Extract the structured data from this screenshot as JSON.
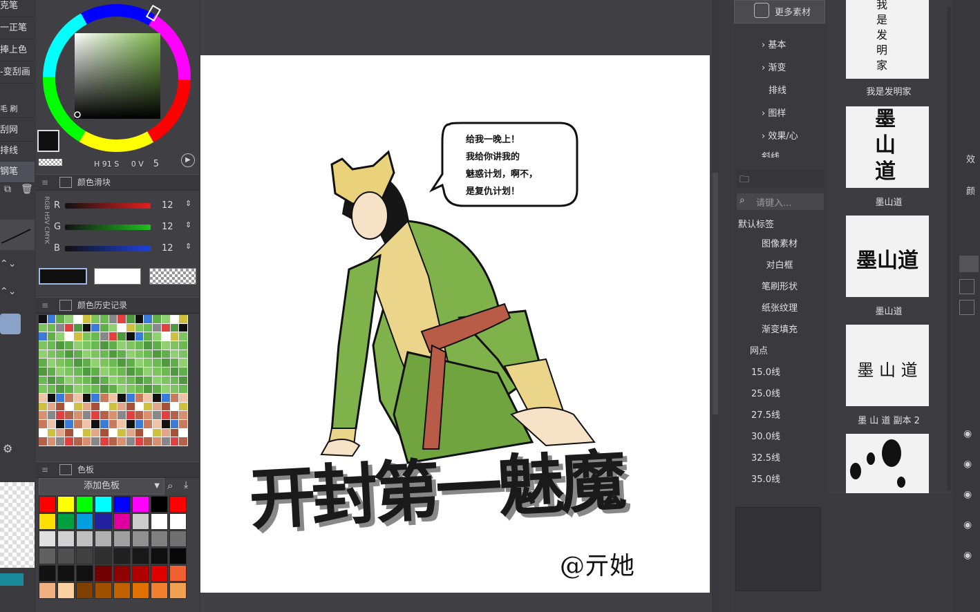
{
  "tool_strip": {
    "items": [
      "克笔",
      "一正笔",
      "捧上色",
      "-变刮画",
      "毛 刷",
      "刮网",
      "排线",
      "钢笔"
    ]
  },
  "color_panel": {
    "hsv_readout": {
      "h_label": "H",
      "h": "91",
      "s_label": "S",
      "v_label": "V",
      "v": "0",
      "extra": "5"
    },
    "slider_panel_title": "颜色滑块",
    "sliders": [
      {
        "label": "R",
        "value": "12",
        "color": "#e02020"
      },
      {
        "label": "G",
        "value": "12",
        "color": "#20c020"
      },
      {
        "label": "B",
        "value": "12",
        "color": "#2040e0"
      }
    ],
    "mode_labels": [
      "RGB",
      "HSV",
      "CMYK"
    ],
    "history_title": "颜色历史记录",
    "palette_title": "色板",
    "palette_select": "添加色板",
    "current_color": "#101010",
    "wheel_ring_color": "#7ab648"
  },
  "canvas": {
    "speech_bubble": [
      "给我一晚上！",
      "我给你讲我的",
      "魅惑计划，啊不，",
      "是复仇计划！"
    ],
    "title_art": "开封第一魅魔",
    "signature": "@亓她"
  },
  "material_tree": {
    "more_materials": "更多素材",
    "items": [
      "基本",
      "渐变",
      "排线",
      "图样",
      "效果/心",
      "斜线"
    ],
    "search_placeholder": "请键入...",
    "tags_header": "默认标签",
    "tags": [
      "图像素材",
      "对白框",
      "笔刷形状",
      "纸张纹理",
      "渐变填充",
      "网点",
      "15.0线",
      "25.0线",
      "27.5线",
      "30.0线",
      "32.5线",
      "35.0线"
    ]
  },
  "thumbnails": [
    {
      "label": "我是发明家",
      "art": "我是发明家"
    },
    {
      "label": "墨山道",
      "art": "墨山道"
    },
    {
      "label": "墨山道",
      "art": "墨山道"
    },
    {
      "label": "墨 山 道 副本 2",
      "art": "墨 山 道"
    }
  ],
  "far_right": {
    "labels": [
      "效",
      "颜"
    ]
  }
}
